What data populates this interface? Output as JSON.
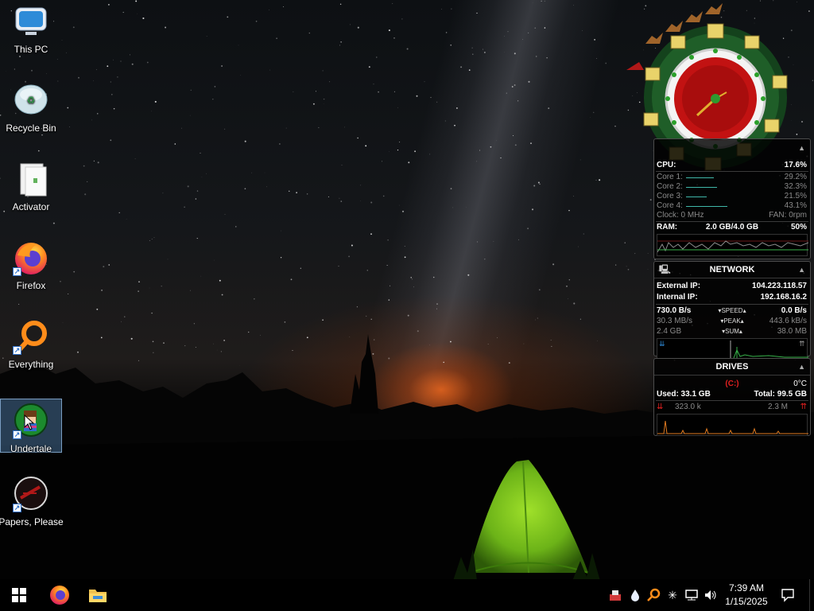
{
  "desktop": {
    "icons": [
      {
        "label": "This PC",
        "icon": "monitor-icon",
        "shortcut": false,
        "selected": false
      },
      {
        "label": "Recycle Bin",
        "icon": "recycle-bin-icon",
        "shortcut": false,
        "selected": false
      },
      {
        "label": "Activator",
        "icon": "document-icon",
        "shortcut": false,
        "selected": false
      },
      {
        "label": "Firefox",
        "icon": "firefox-icon",
        "shortcut": true,
        "selected": false
      },
      {
        "label": "Everything",
        "icon": "magnifier-icon",
        "shortcut": true,
        "selected": false
      },
      {
        "label": "Undertale",
        "icon": "undertale-icon",
        "shortcut": true,
        "selected": true
      },
      {
        "label": "Papers, Please",
        "icon": "papers-please-icon",
        "shortcut": true,
        "selected": false
      }
    ]
  },
  "widgets": {
    "cpu": {
      "cpu_label": "CPU:",
      "cpu_value": "17.6%",
      "cores": [
        {
          "label": "Core 1:",
          "value": "29.2%",
          "load": 0.292
        },
        {
          "label": "Core 2:",
          "value": "32.3%",
          "load": 0.323
        },
        {
          "label": "Core 3:",
          "value": "21.5%",
          "load": 0.215
        },
        {
          "label": "Core 4:",
          "value": "43.1%",
          "load": 0.431
        }
      ],
      "clock_text": "Clock: 0 MHz",
      "fan_text": "FAN: 0rpm",
      "ram_label": "RAM:",
      "ram_value": "2.0 GB/4.0 GB",
      "ram_percent": "50%"
    },
    "network": {
      "title": "NETWORK",
      "external_label": "External IP:",
      "external_value": "104.223.118.57",
      "internal_label": "Internal IP:",
      "internal_value": "192.168.16.2",
      "speed_down": "730.0 B/s",
      "speed_label": "SPEED",
      "speed_up": "0.0 B/s",
      "peak_down": "30.3 MB/s",
      "peak_label": "PEAK",
      "peak_up": "443.6 kB/s",
      "sum_down": "2.4 GB",
      "sum_label": "SUM",
      "sum_up": "38.0 MB"
    },
    "drives": {
      "title": "DRIVES",
      "drive_letter": "(C:)",
      "temperature": "0°C",
      "used_text": "Used: 33.1 GB",
      "total_text": "Total: 99.5 GB",
      "read_rate": "323.0 k",
      "write_rate": "2.3 M"
    }
  },
  "taskbar": {
    "start_icon": "windows-start-icon",
    "pinned": [
      "firefox-icon",
      "file-explorer-icon"
    ],
    "tray": [
      "antivirus-icon",
      "dropbox-icon",
      "everything-search-icon",
      "snowflake-icon",
      "network-icon",
      "volume-icon"
    ],
    "time": "7:39 AM",
    "date": "1/15/2025",
    "notification_icon": "action-center-icon"
  },
  "colors": {
    "accent_teal": "#3fb7a8",
    "warning_red": "#e02020",
    "selection": "#466e96"
  }
}
